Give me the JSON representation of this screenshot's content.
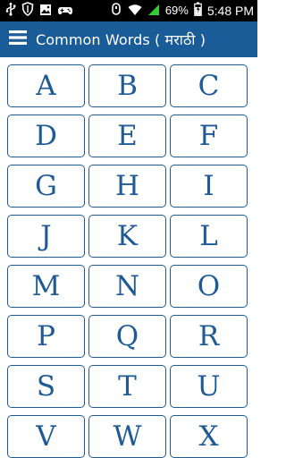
{
  "status_bar": {
    "battery": "69%",
    "time": "5:48",
    "ampm": "PM",
    "icons": [
      "usb-icon",
      "shield-icon",
      "image-icon",
      "gamepad-icon",
      "unknown-icon",
      "wifi-icon",
      "signal-icon",
      "battery-icon"
    ]
  },
  "app_bar": {
    "title": "Common Words ( मराठी )",
    "menu_icon": "hamburger-menu-icon"
  },
  "letters": [
    "A",
    "B",
    "C",
    "D",
    "E",
    "F",
    "G",
    "H",
    "I",
    "J",
    "K",
    "L",
    "M",
    "N",
    "O",
    "P",
    "Q",
    "R",
    "S",
    "T",
    "U",
    "V",
    "W",
    "X"
  ],
  "colors": {
    "app_bar": "#1a5c98",
    "accent": "#1e5a96",
    "status_bar": "#000000",
    "background": "#ffffff"
  }
}
